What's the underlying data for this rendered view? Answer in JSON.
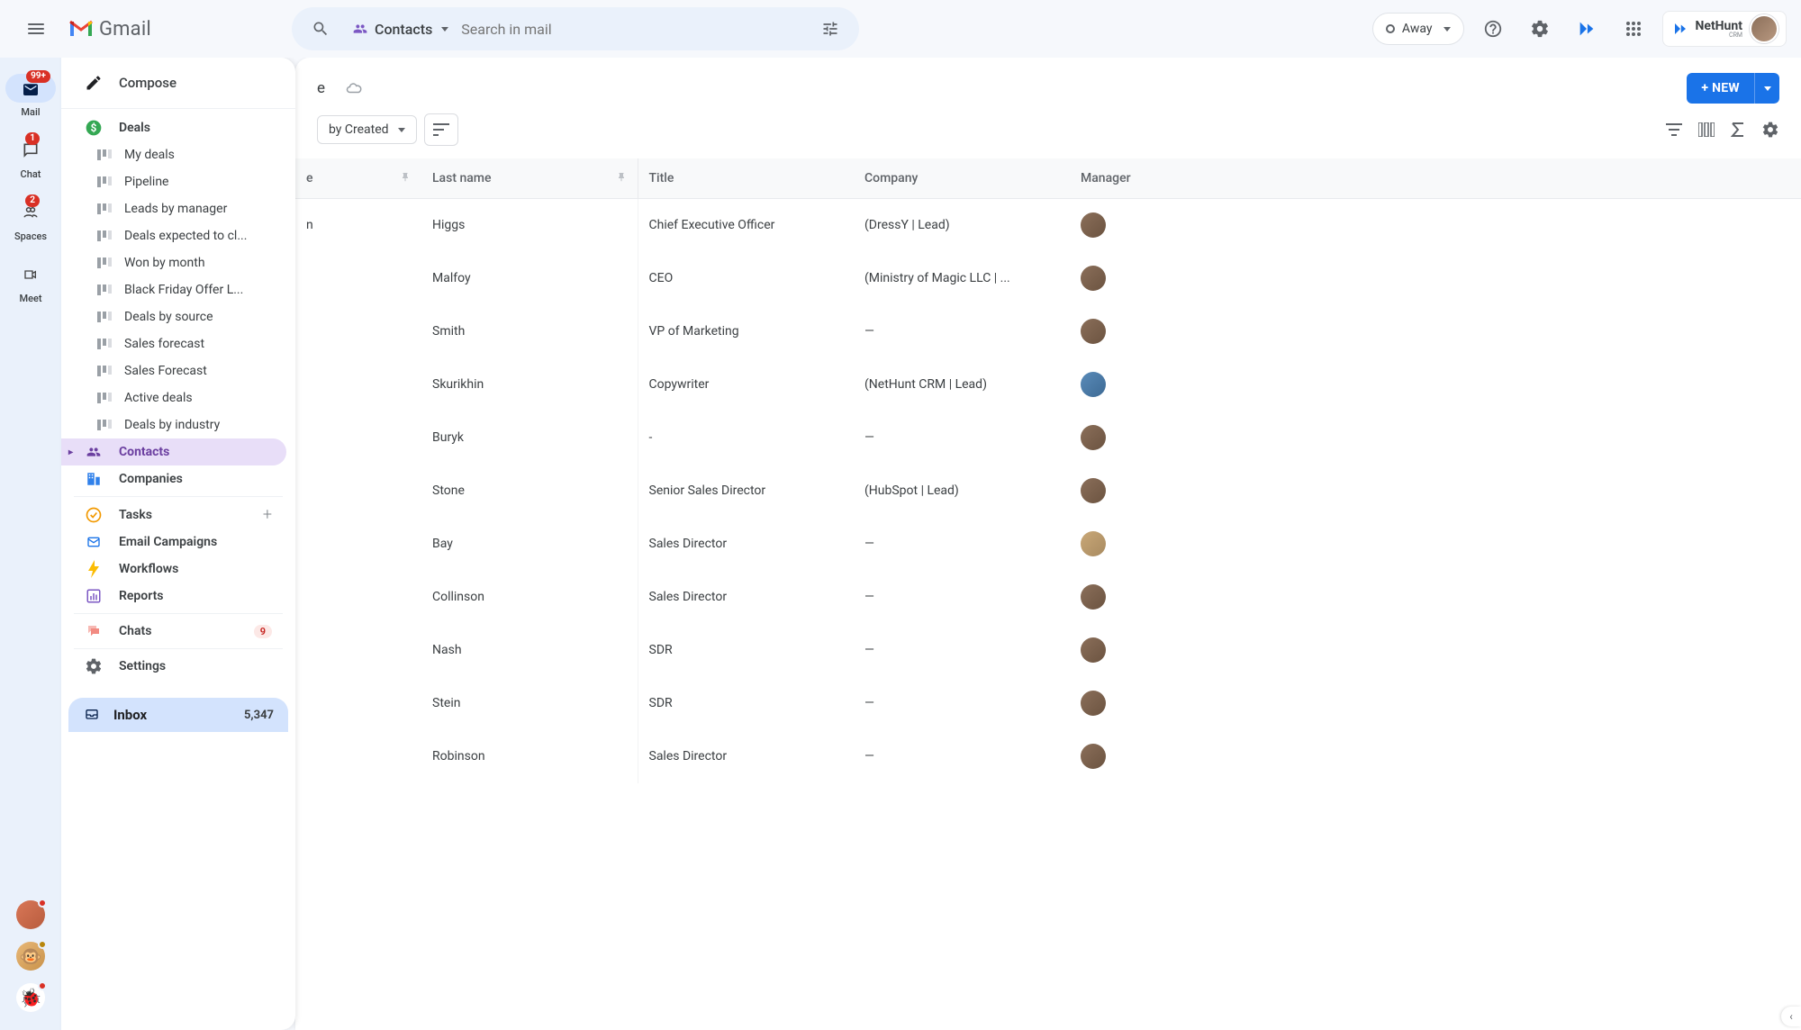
{
  "header": {
    "app_name": "Gmail",
    "search_placeholder": "Search in mail",
    "scope_chip_label": "Contacts",
    "status_label": "Away",
    "brand_pill": "NetHunt",
    "brand_pill_sub": "CRM"
  },
  "rail": {
    "items": [
      {
        "label": "Mail",
        "badge": "99+",
        "active": true
      },
      {
        "label": "Chat",
        "badge": "1",
        "active": false
      },
      {
        "label": "Spaces",
        "badge": "2",
        "active": false
      },
      {
        "label": "Meet",
        "badge": "",
        "active": false
      }
    ]
  },
  "sidebar": {
    "compose_label": "Compose",
    "sections": {
      "deals": {
        "label": "Deals",
        "items": [
          "My deals",
          "Pipeline",
          "Leads by manager",
          "Deals expected to cl...",
          "Won by month",
          "Black Friday Offer L...",
          "Deals by source",
          "Sales forecast",
          "Sales Forecast",
          "Active deals",
          "Deals by industry"
        ]
      },
      "contacts_label": "Contacts",
      "companies_label": "Companies",
      "tasks_label": "Tasks",
      "campaigns_label": "Email Campaigns",
      "workflows_label": "Workflows",
      "reports_label": "Reports",
      "chats_label": "Chats",
      "chats_badge": "9",
      "settings_label": "Settings",
      "inbox_label": "Inbox",
      "inbox_count": "5,347"
    }
  },
  "toolbar": {
    "new_button": "+ NEW",
    "sort_label": "by Created"
  },
  "table": {
    "col_firstname_partial": "e",
    "columns": [
      "Last name",
      "Title",
      "Company",
      "Manager"
    ],
    "rows": [
      {
        "first": "n",
        "last": "Higgs",
        "title": "Chief Executive Officer",
        "company": "(DressY | Lead)",
        "mgr": "brown"
      },
      {
        "first": "",
        "last": "Malfoy",
        "title": "CEO",
        "company": "(Ministry of Magic LLC | ...",
        "mgr": "brown"
      },
      {
        "first": "",
        "last": "Smith",
        "title": "VP of Marketing",
        "company": "—",
        "mgr": "brown"
      },
      {
        "first": "",
        "last": "Skurikhin",
        "title": "Copywriter",
        "company": "(NetHunt CRM | Lead)",
        "mgr": "blue"
      },
      {
        "first": "",
        "last": "Buryk",
        "title": "-",
        "company": "—",
        "mgr": "brown"
      },
      {
        "first": "",
        "last": "Stone",
        "title": "Senior Sales Director",
        "company": "(HubSpot | Lead)",
        "mgr": "brown"
      },
      {
        "first": "",
        "last": "Bay",
        "title": "Sales Director",
        "company": "—",
        "mgr": "light"
      },
      {
        "first": "",
        "last": "Collinson",
        "title": "Sales Director",
        "company": "—",
        "mgr": "brown"
      },
      {
        "first": "",
        "last": "Nash",
        "title": "SDR",
        "company": "—",
        "mgr": "brown"
      },
      {
        "first": "",
        "last": "Stein",
        "title": "SDR",
        "company": "—",
        "mgr": "brown"
      },
      {
        "first": "",
        "last": "Robinson",
        "title": "Sales Director",
        "company": "—",
        "mgr": "brown"
      }
    ]
  }
}
